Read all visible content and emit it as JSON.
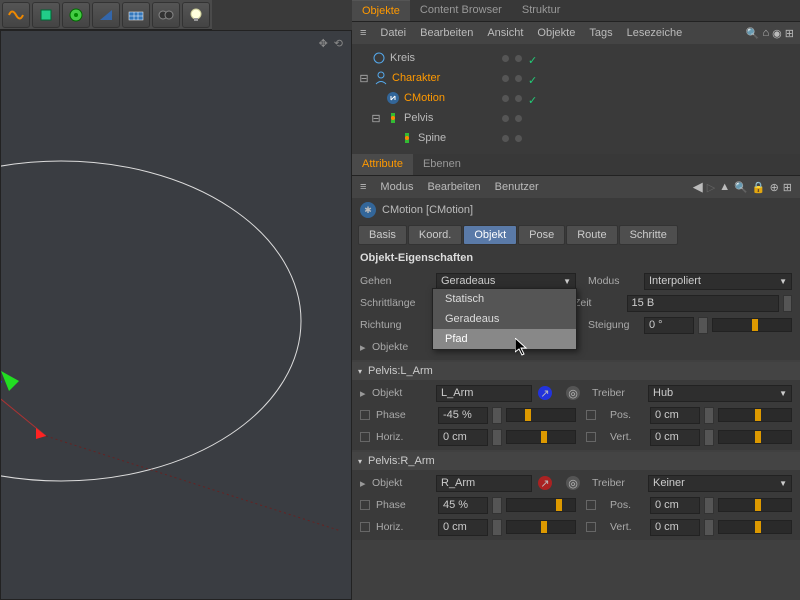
{
  "toolbar_icons": [
    "snake",
    "cube",
    "gear",
    "wedge",
    "grid",
    "goggles",
    "bulb"
  ],
  "top_tabs": {
    "active": "Objekte",
    "items": [
      "Objekte",
      "Content Browser",
      "Struktur"
    ]
  },
  "obj_menu": [
    "Datei",
    "Bearbeiten",
    "Ansicht",
    "Objekte",
    "Tags",
    "Lesezeiche"
  ],
  "tree": {
    "kreis": "Kreis",
    "charakter": "Charakter",
    "cmotion": "CMotion",
    "pelvis": "Pelvis",
    "spine": "Spine"
  },
  "attr_tabs": {
    "active": "Attribute",
    "items": [
      "Attribute",
      "Ebenen"
    ]
  },
  "attr_menu": [
    "Modus",
    "Bearbeiten",
    "Benutzer"
  ],
  "obj_title": "CMotion [CMotion]",
  "sub_tabs": {
    "active": "Objekt",
    "items": [
      "Basis",
      "Koord.",
      "Objekt",
      "Pose",
      "Route",
      "Schritte"
    ]
  },
  "section": "Objekt-Eigenschaften",
  "props": {
    "gehen_label": "Gehen",
    "gehen_value": "Geradeaus",
    "modus_label": "Modus",
    "modus_value": "Interpoliert",
    "schritt_label": "Schrittlänge",
    "zeit_label": "Zeit",
    "zeit_value": "15 B",
    "richtung_label": "Richtung",
    "steigung_label": "Steigung",
    "steigung_value": "0 °",
    "objekte_label": "Objekte"
  },
  "popup": {
    "items": [
      "Statisch",
      "Geradeaus",
      "Pfad"
    ],
    "hover_index": 2
  },
  "groups": {
    "larm": {
      "header": "Pelvis:L_Arm",
      "objekt_label": "Objekt",
      "objekt_value": "L_Arm",
      "treiber_label": "Treiber",
      "treiber_value": "Hub",
      "phase_label": "Phase",
      "phase_value": "-45 %",
      "pos_label": "Pos.",
      "pos_value": "0 cm",
      "horiz_label": "Horiz.",
      "horiz_value": "0 cm",
      "vert_label": "Vert.",
      "vert_value": "0 cm"
    },
    "rarm": {
      "header": "Pelvis:R_Arm",
      "objekt_label": "Objekt",
      "objekt_value": "R_Arm",
      "treiber_label": "Treiber",
      "treiber_value": "Keiner",
      "phase_label": "Phase",
      "phase_value": "45 %",
      "pos_label": "Pos.",
      "pos_value": "0 cm",
      "horiz_label": "Horiz.",
      "horiz_value": "0 cm",
      "vert_label": "Vert.",
      "vert_value": "0 cm"
    }
  },
  "chart_data": {
    "type": "table",
    "note": "no chart present"
  }
}
